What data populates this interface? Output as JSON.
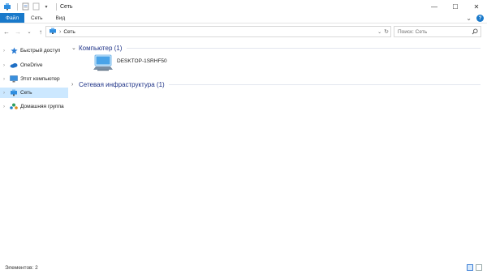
{
  "window": {
    "title": "Сеть",
    "minimize_glyph": "—",
    "maximize_glyph": "☐",
    "close_glyph": "✕"
  },
  "ribbon": {
    "tabs": [
      {
        "label": "Файл"
      },
      {
        "label": "Сеть"
      },
      {
        "label": "Вид"
      }
    ],
    "collapse_glyph": "⌄",
    "help_glyph": "?"
  },
  "address": {
    "path": "Сеть",
    "separator": "›",
    "dropdown_glyph": "⌄",
    "refresh_glyph": "↻"
  },
  "search": {
    "placeholder": "Поиск: Сеть"
  },
  "navigation": {
    "items": [
      {
        "label": "Быстрый доступ",
        "icon": "star-icon"
      },
      {
        "label": "OneDrive",
        "icon": "cloud-icon"
      },
      {
        "label": "Этот компьютер",
        "icon": "computer-icon"
      },
      {
        "label": "Сеть",
        "icon": "network-icon",
        "selected": true
      },
      {
        "label": "Домашняя группа",
        "icon": "homegroup-icon"
      }
    ]
  },
  "content": {
    "groups": [
      {
        "label": "Компьютер (1)",
        "expanded": true
      },
      {
        "label": "Сетевая инфраструктура (1)",
        "expanded": false
      }
    ],
    "computer_name": "DESKTOP-1SRHF50"
  },
  "status": {
    "items_count": "Элементов: 2"
  },
  "colors": {
    "accent": "#1979ca",
    "selected_bg": "#cce8ff",
    "group_header": "#1e3287"
  }
}
